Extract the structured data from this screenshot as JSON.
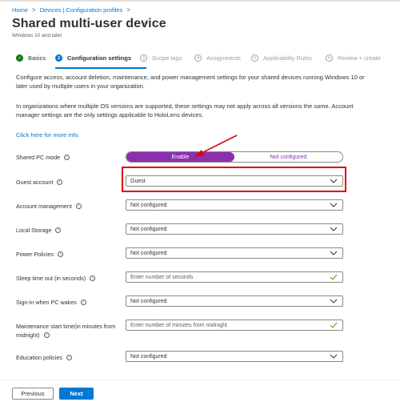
{
  "breadcrumb": {
    "home": "Home",
    "sep": ">",
    "section": "Devices | Configuration profiles"
  },
  "header": {
    "title": "Shared multi-user device",
    "more": "···",
    "subtitle": "Windows 10 and later"
  },
  "steps": [
    {
      "num": "✓",
      "label": "Basics",
      "state": "done"
    },
    {
      "num": "2",
      "label": "Configuration settings",
      "state": "active"
    },
    {
      "num": "3",
      "label": "Scope tags",
      "state": "pending"
    },
    {
      "num": "4",
      "label": "Assignments",
      "state": "pending"
    },
    {
      "num": "5",
      "label": "Applicability Rules",
      "state": "pending"
    },
    {
      "num": "6",
      "label": "Review + create",
      "state": "pending"
    }
  ],
  "description": {
    "para1": "Configure access, account deletion, maintenance, and power management settings for your shared devices running Windows 10 or later used by multiple users in your organization.",
    "para2": "In organizations where multiple OS versions are supported, these settings may not apply across all versions the same. Account manager settings are the only settings applicable to HoloLens devices.",
    "link": "Click here for more info."
  },
  "settings": {
    "shared_pc_mode": {
      "label": "Shared PC mode",
      "enable": "Enable",
      "not_configured": "Not configured"
    },
    "guest_account": {
      "label": "Guest account",
      "value": "Guest"
    },
    "account_management": {
      "label": "Account management",
      "value": "Not configured"
    },
    "local_storage": {
      "label": "Local Storage",
      "value": "Not configured"
    },
    "power_policies": {
      "label": "Power Policies",
      "value": "Not configured"
    },
    "sleep_timeout": {
      "label": "Sleep time out (in seconds)",
      "placeholder": "Enter number of seconds"
    },
    "signin_wake": {
      "label": "Sign-in when PC wakes",
      "value": "Not configured"
    },
    "maintenance_start": {
      "label_line1": "Maintenance start time(in minutes from",
      "label_line2": "midnight)",
      "placeholder": "Enter number of minutes from midnight"
    },
    "education_policies": {
      "label": "Education policies",
      "value": "Not configured"
    }
  },
  "footer": {
    "previous": "Previous",
    "next": "Next"
  },
  "colors": {
    "accent": "#0078d4",
    "toggle_on": "#8b2fb1",
    "highlight": "#e00000",
    "done": "#107c10"
  }
}
